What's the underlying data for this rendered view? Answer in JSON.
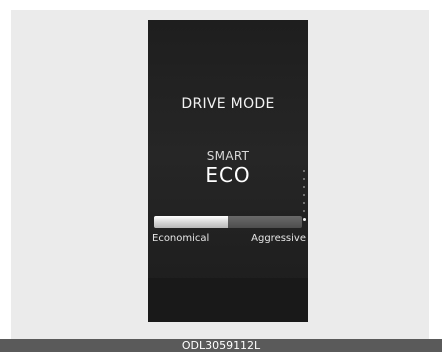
{
  "display": {
    "title": "DRIVE MODE",
    "mode_sub": "SMART",
    "mode_main": "ECO",
    "gauge": {
      "left_label": "Economical",
      "right_label": "Aggressive",
      "level_fraction": 0.5
    }
  },
  "caption": "ODL3059112L",
  "colors": {
    "screen_background": "#1e1e1e",
    "frame_background": "#ebebeb",
    "caption_background": "#5a5a5a",
    "text": "#ffffff"
  }
}
